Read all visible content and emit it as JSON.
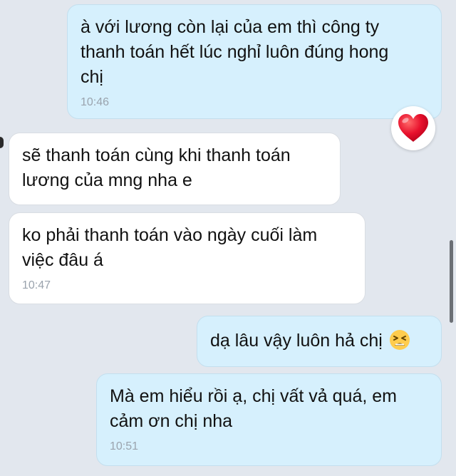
{
  "messages": [
    {
      "direction": "outgoing",
      "text": "à với lương còn lại của em thì công ty\nthanh toán hết lúc nghỉ luôn đúng hong\nchị",
      "time": "10:46",
      "reaction": "heart-icon"
    },
    {
      "direction": "incoming",
      "text": "sẽ thanh toán cùng khi thanh toán\nlương của mng nha e"
    },
    {
      "direction": "incoming",
      "text": "ko phải thanh toán vào ngày cuối làm\nviệc đâu á",
      "time": "10:47"
    },
    {
      "direction": "outgoing",
      "text": "dạ lâu vậy luôn hả chị",
      "emoji": "tired-face-emoji"
    },
    {
      "direction": "outgoing",
      "text": "Mà em hiểu rồi ạ, chị vất vả quá, em\ncảm ơn chị nha",
      "time": "10:51"
    }
  ],
  "colors": {
    "background": "#e2e7ee",
    "outgoing_bubble": "#d6f0fd",
    "incoming_bubble": "#ffffff",
    "timestamp": "#9aa3ad",
    "heart": "#e8112d"
  }
}
